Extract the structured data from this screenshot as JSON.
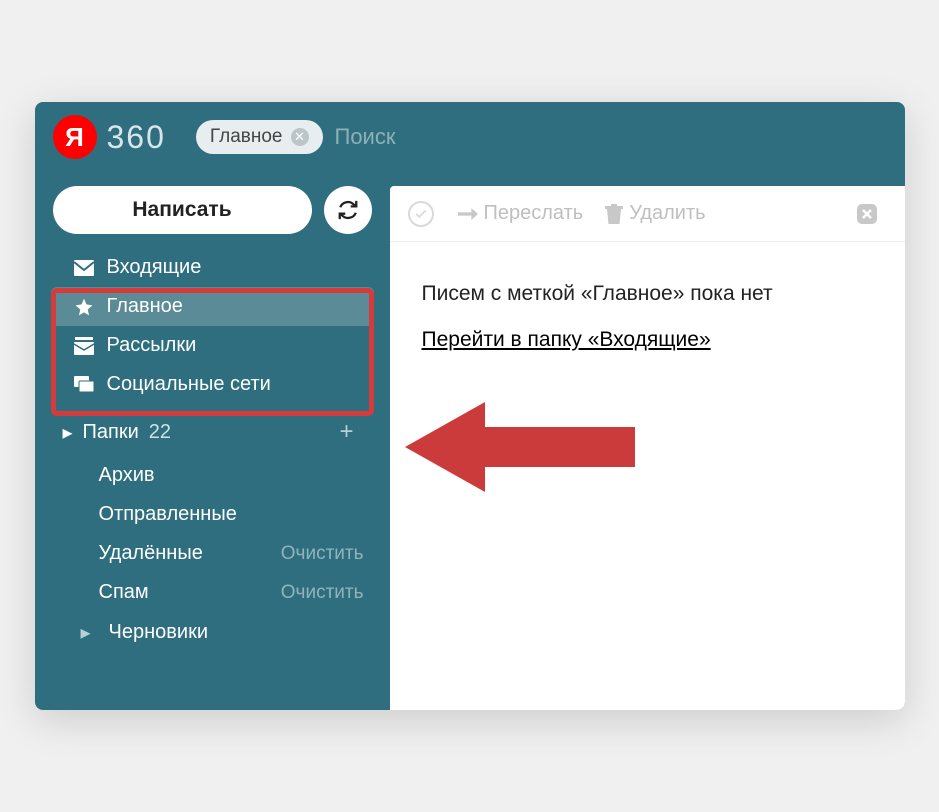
{
  "logo": {
    "letter": "Я",
    "text": "360"
  },
  "search": {
    "chip": "Главное",
    "placeholder": "Поиск"
  },
  "compose": {
    "label": "Написать"
  },
  "sidebar": {
    "inbox": "Входящие",
    "main": "Главное",
    "newsletters": "Рассылки",
    "social": "Социальные сети",
    "folders_label": "Папки",
    "folders_count": "22",
    "archive": "Архив",
    "sent": "Отправленные",
    "deleted": "Удалённые",
    "spam": "Спам",
    "drafts": "Черновики",
    "clear": "Очистить"
  },
  "toolbar": {
    "forward": "Переслать",
    "delete": "Удалить"
  },
  "content": {
    "empty_message": "Писем с меткой «Главное» пока нет",
    "goto_link": "Перейти в папку «Входящие»"
  }
}
